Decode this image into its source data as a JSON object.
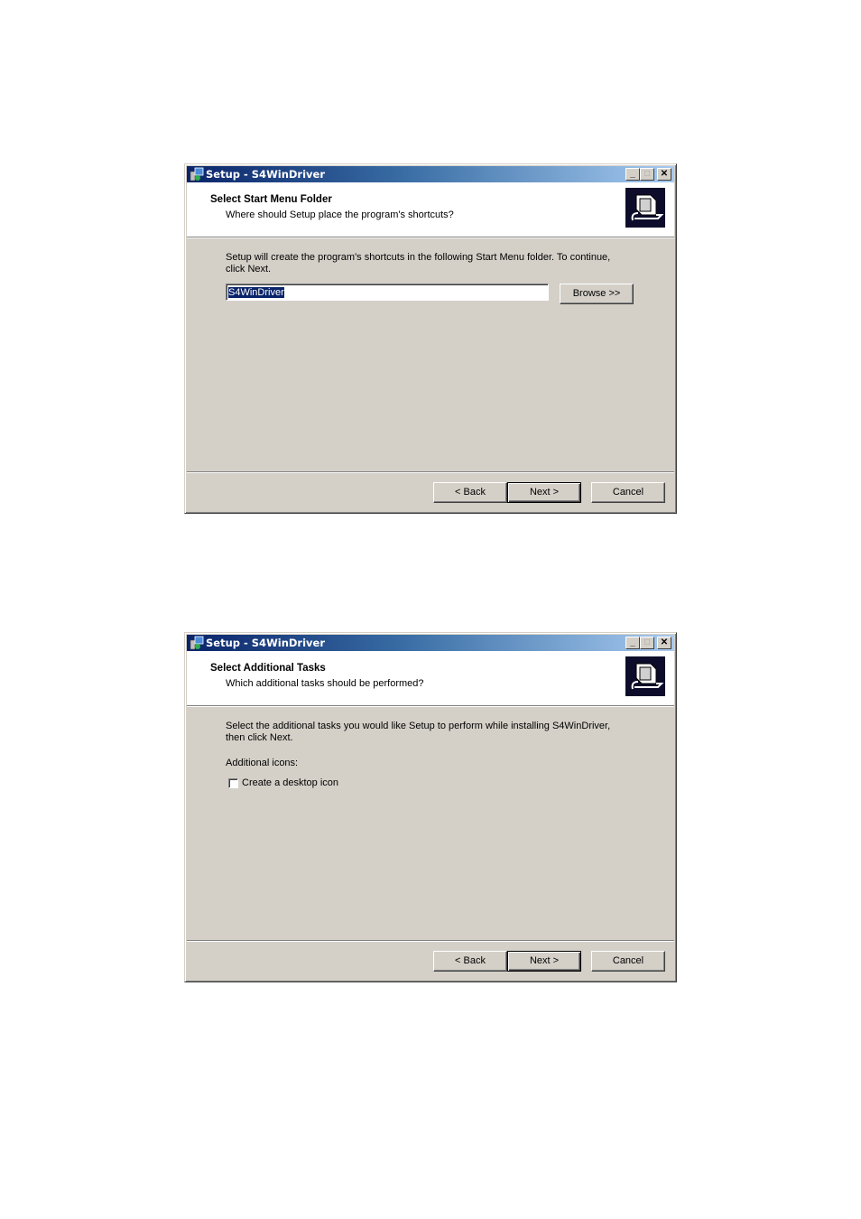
{
  "dialogs": [
    {
      "window_title": "Setup - S4WinDriver",
      "header_title": "Select Start Menu Folder",
      "header_subtitle": "Where should Setup place the program's shortcuts?",
      "body_text": "Setup will create the program's shortcuts in the following Start Menu folder. To continue, click Next.",
      "folder_input_value": "S4WinDriver",
      "browse_label": "Browse >>",
      "back_label": "< Back",
      "next_label": "Next >",
      "cancel_label": "Cancel"
    },
    {
      "window_title": "Setup - S4WinDriver",
      "header_title": "Select Additional Tasks",
      "header_subtitle": "Which additional tasks should be performed?",
      "body_text": "Select the additional tasks you would like Setup to perform while installing S4WinDriver, then click Next.",
      "group_label": "Additional icons:",
      "checkbox_label": "Create a desktop icon",
      "checkbox_checked": false,
      "back_label": "< Back",
      "next_label": "Next >",
      "cancel_label": "Cancel"
    }
  ],
  "colors": {
    "titlebar_start": "#0a246a",
    "titlebar_end": "#a6caf0",
    "face": "#d4d0c8",
    "selection": "#0a246a"
  }
}
